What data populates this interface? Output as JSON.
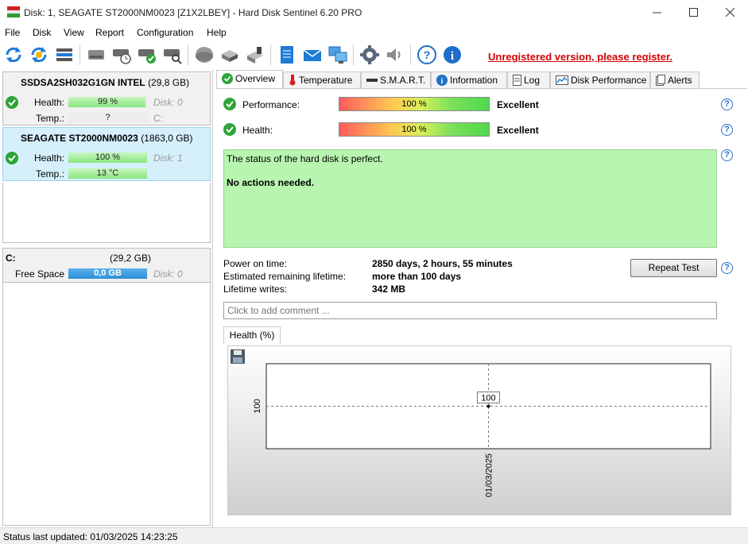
{
  "window": {
    "title": "Disk: 1, SEAGATE ST2000NM0023 [Z1X2LBEY]  -  Hard Disk Sentinel 6.20 PRO"
  },
  "menu": [
    "File",
    "Disk",
    "View",
    "Report",
    "Configuration",
    "Help"
  ],
  "toolbar": {
    "icons": [
      "refresh-icon",
      "refresh-all-icon",
      "disk-list-icon",
      "disk-icon",
      "disk-schedule-icon",
      "disk-check-icon",
      "disk-search-icon",
      "disk-surface-icon",
      "disk-tools-icon",
      "disk-info-icon",
      "report-icon",
      "email-icon",
      "network-icon",
      "settings-icon",
      "sound-icon",
      "help-icon",
      "info-icon"
    ],
    "register_text": "Unregistered version, please register."
  },
  "disks": [
    {
      "model": "SSDSA2SH032G1GN INTEL",
      "size": "(29,8 GB)",
      "health_label": "Health:",
      "health_value": "99 %",
      "health_pct": 99,
      "disk_label": "Disk: 0",
      "temp_label": "Temp.:",
      "temp_value": "?",
      "drive_letter": "C:"
    },
    {
      "model": "SEAGATE ST2000NM0023",
      "size": "(1863,0 GB)",
      "health_label": "Health:",
      "health_value": "100 %",
      "health_pct": 100,
      "disk_label": "Disk: 1",
      "temp_label": "Temp.:",
      "temp_value": "13 °C"
    }
  ],
  "volume": {
    "letter": "C:",
    "size": "(29,2 GB)",
    "free_label": "Free Space",
    "free_value": "0,0 GB",
    "disk_label": "Disk: 0"
  },
  "tabs": [
    "Overview",
    "Temperature",
    "S.M.A.R.T.",
    "Information",
    "Log",
    "Disk Performance",
    "Alerts"
  ],
  "overview": {
    "performance_label": "Performance:",
    "performance_value": "100 %",
    "performance_pct": 100,
    "performance_rating": "Excellent",
    "health_label": "Health:",
    "health_value": "100 %",
    "health_pct": 100,
    "health_rating": "Excellent",
    "status_line1": "The status of the hard disk is perfect.",
    "status_line2": "No actions needed.",
    "power_on_label": "Power on time:",
    "power_on_value": "2850 days, 2 hours, 55 minutes",
    "remaining_label": "Estimated remaining lifetime:",
    "remaining_value": "more than 100 days",
    "writes_label": "Lifetime writes:",
    "writes_value": "342 MB",
    "repeat_button": "Repeat Test",
    "comment_placeholder": "Click to add comment ..."
  },
  "chart_tab": "Health (%)",
  "chart_data": {
    "type": "line",
    "x": [
      "01/03/2025"
    ],
    "series": [
      {
        "values": [
          100
        ]
      }
    ],
    "ytick": "100",
    "data_label": "100"
  },
  "statusbar": {
    "text": "Status last updated: 01/03/2025 14:23:25"
  },
  "colors": {
    "register_link": "#d40000",
    "selected_disk_bg": "#d5f0fb",
    "status_ok_bg": "#b8f5b0",
    "free_space_bar": "#2c8fd6"
  }
}
